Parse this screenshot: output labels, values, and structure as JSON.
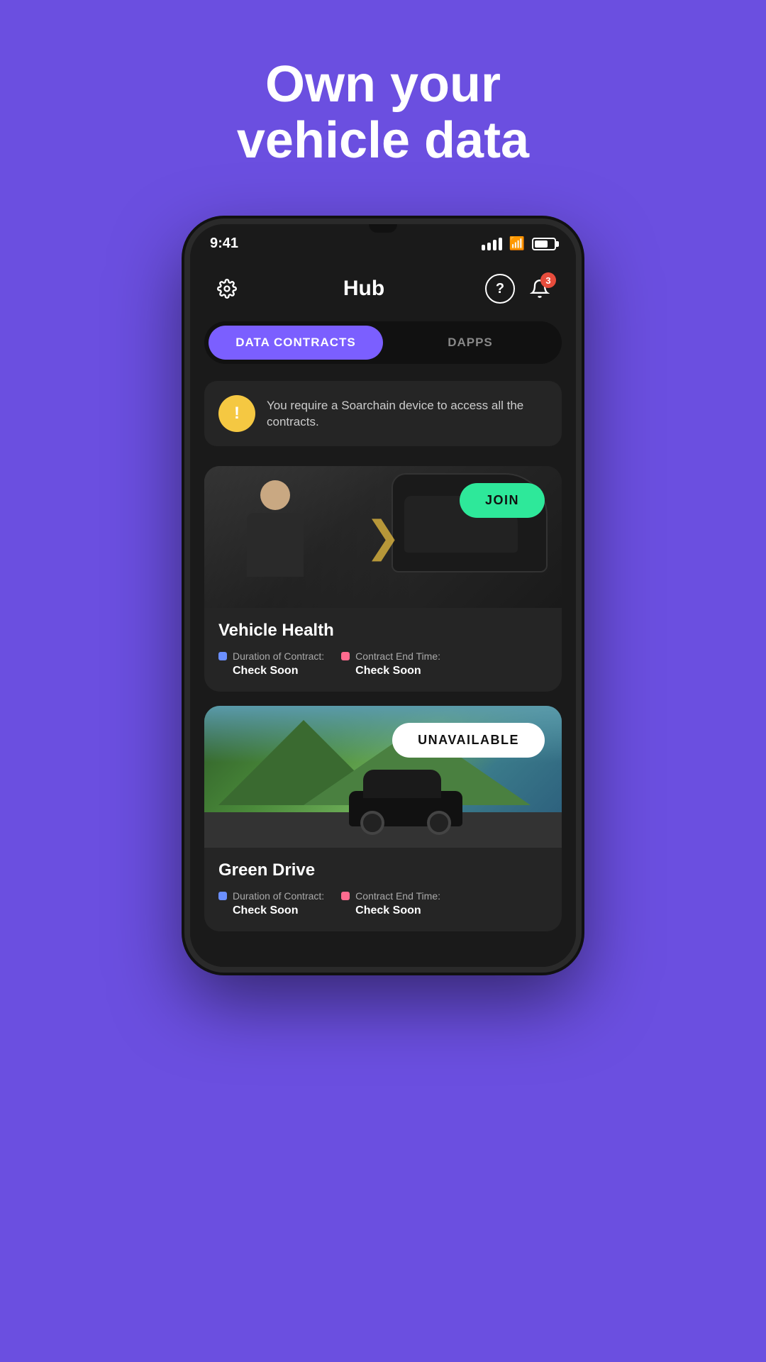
{
  "page": {
    "background_color": "#6B4FE0",
    "headline_line1": "Own your",
    "headline_line2": "vehicle data"
  },
  "status_bar": {
    "time": "9:41",
    "notification_count": "3"
  },
  "header": {
    "title": "Hub"
  },
  "tabs": [
    {
      "label": "DATA CONTRACTS",
      "active": true
    },
    {
      "label": "DAPPS",
      "active": false
    }
  ],
  "alert": {
    "message": "You require a Soarchain device to access all the contracts."
  },
  "contracts": [
    {
      "title": "Vehicle Health",
      "action_label": "JOIN",
      "action_type": "join",
      "duration_label": "Duration of Contract:",
      "duration_value": "Check Soon",
      "end_time_label": "Contract End Time:",
      "end_time_value": "Check Soon"
    },
    {
      "title": "Green Drive",
      "action_label": "UNAVAILABLE",
      "action_type": "unavailable",
      "duration_label": "Duration of Contract:",
      "duration_value": "Check Soon",
      "end_time_label": "Contract End Time:",
      "end_time_value": "Check Soon"
    }
  ]
}
